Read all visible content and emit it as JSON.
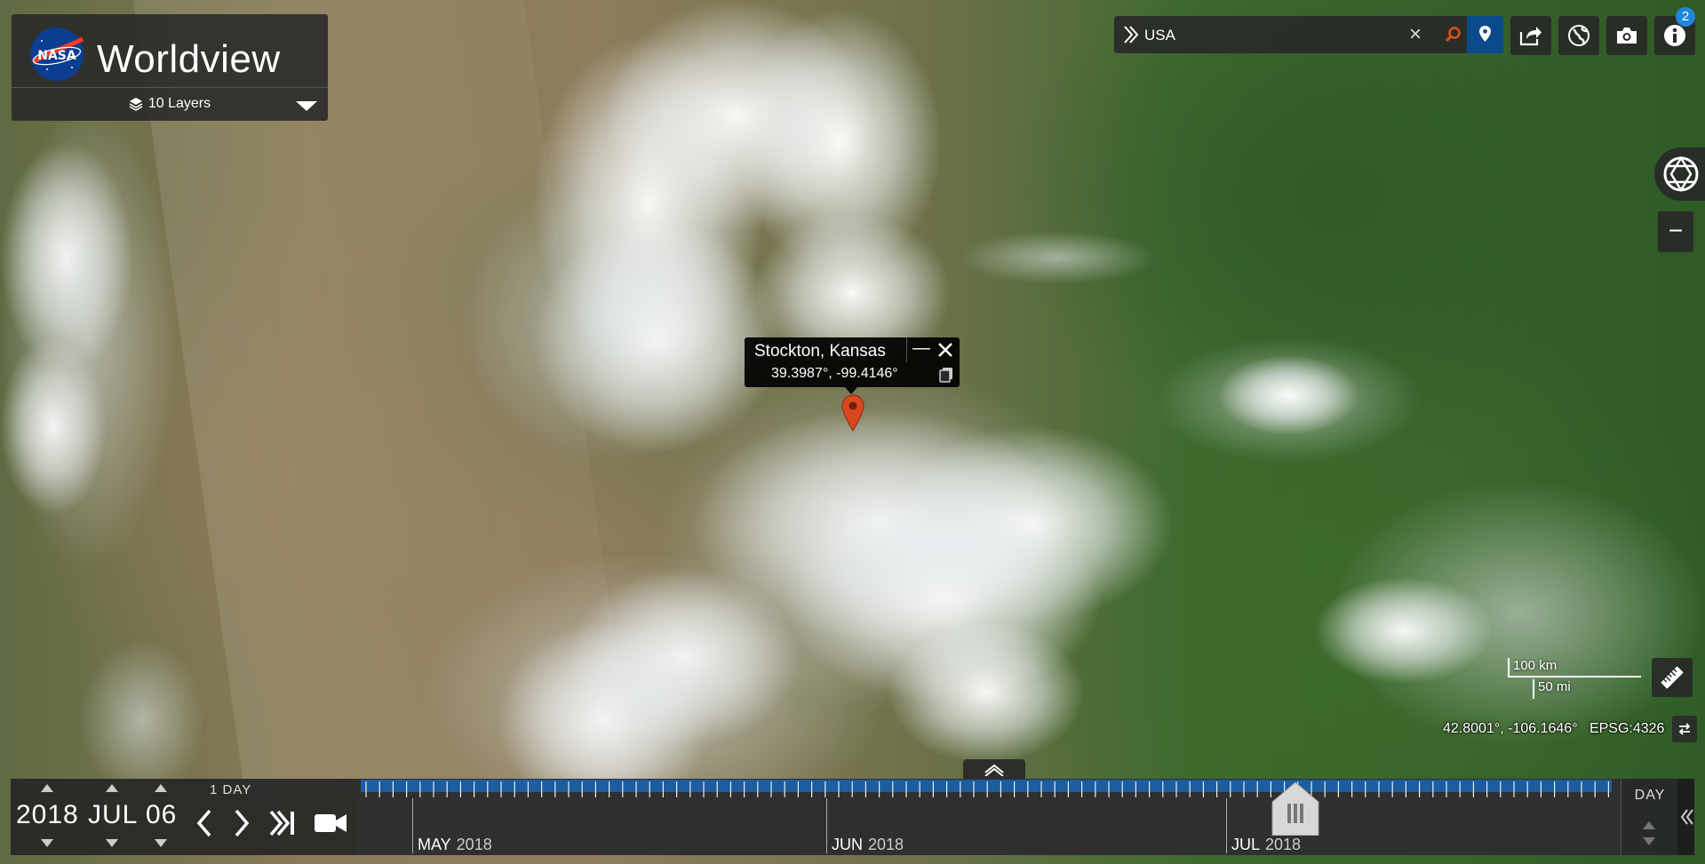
{
  "app": {
    "title": "Worldview",
    "layers_label": "10 Layers"
  },
  "search": {
    "value": "USA",
    "clear_label": "×",
    "expand_icon": "double-chevron-right-icon",
    "search_icon": "magnifier-icon",
    "pin_icon": "location-pin-icon",
    "accent": "#e0531b",
    "pin_bg": "#0a4a8a"
  },
  "toolbar": {
    "buttons": [
      "share-icon",
      "projection-icon",
      "camera-icon",
      "info-icon"
    ],
    "info_badge": "2"
  },
  "map_controls": {
    "zoom_out_label": "−",
    "scale_km": "100 km",
    "scale_mi": "50 mi",
    "cursor_coords": "42.8001°, -106.1646°",
    "projection": "EPSG:4326"
  },
  "location_popup": {
    "name": "Stockton, Kansas",
    "coordinates": "39.3987°, -99.4146°",
    "minimize_label": "—",
    "marker_color": "#d9471f"
  },
  "timeline": {
    "year": "2018",
    "month": "JUL",
    "day": "06",
    "interval": "1  DAY",
    "zoom_level": "DAY",
    "months": [
      {
        "name": "MAY",
        "year": "2018"
      },
      {
        "name": "JUN",
        "year": "2018"
      },
      {
        "name": "JUL",
        "year": "2018"
      }
    ],
    "tick_color": "#1d5c9e"
  }
}
